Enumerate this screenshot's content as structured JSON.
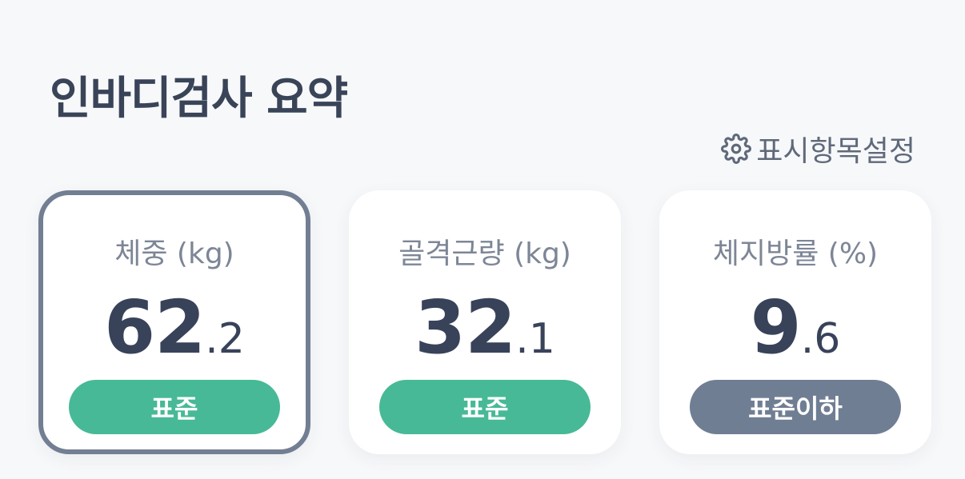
{
  "header": {
    "title": "인바디검사 요약"
  },
  "settings": {
    "label": "표시항목설정",
    "icon": "gear-icon"
  },
  "colors": {
    "standard": "#47b996",
    "below_standard": "#707e93",
    "selected_border": "#727e92",
    "value_text": "#38435a"
  },
  "cards": [
    {
      "label": "체중 (kg)",
      "value_int": "62",
      "value_dec": ".2",
      "status": "표준",
      "status_color": "#47b996"
    },
    {
      "label": "골격근량 (kg)",
      "value_int": "32",
      "value_dec": ".1",
      "status": "표준",
      "status_color": "#47b996"
    },
    {
      "label": "체지방률 (%)",
      "value_int": "9",
      "value_dec": ".6",
      "status": "표준이하",
      "status_color": "#707e93"
    }
  ]
}
